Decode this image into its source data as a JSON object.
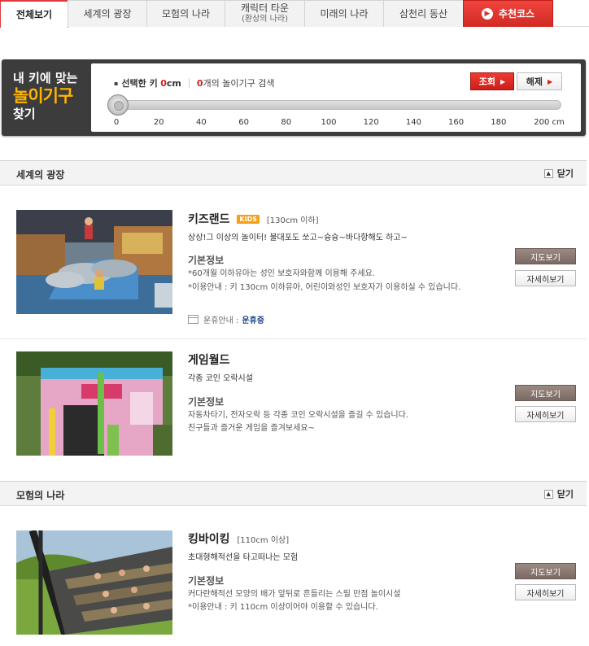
{
  "tabs": [
    {
      "label": "전체보기",
      "sub": ""
    },
    {
      "label": "세계의 광장",
      "sub": ""
    },
    {
      "label": "모험의 나라",
      "sub": ""
    },
    {
      "label": "캐릭터 타운",
      "sub": "(환상의 나라)"
    },
    {
      "label": "미래의 나라",
      "sub": ""
    },
    {
      "label": "삼천리 동산",
      "sub": ""
    }
  ],
  "reco_tab": "추천코스",
  "finder": {
    "title_line1": "내 키에 맞는",
    "title_line2": "놀이기구",
    "title_line3": "찾기",
    "selected_label": "선택한 키",
    "selected_value": "0",
    "selected_unit": "cm",
    "count_value": "0",
    "count_label": "개의 놀이기구 검색",
    "search_button": "조회",
    "reset_button": "해제",
    "slider_value": 0,
    "ticks": [
      "0",
      "20",
      "40",
      "60",
      "80",
      "100",
      "120",
      "140",
      "160",
      "180",
      "200 cm"
    ]
  },
  "sections": [
    {
      "title": "세계의 광장",
      "close_label": "닫기"
    },
    {
      "title": "모험의 나라",
      "close_label": "닫기"
    }
  ],
  "items": [
    {
      "name": "키즈랜드",
      "badge": "KIDS",
      "restriction": "[130cm 이하]",
      "desc": "상상!그 이상의 놀이터! 불대포도 쏘고~슝슝~바다항해도 하고~",
      "info_title": "기본정보",
      "lines": [
        "*60개월 이하유아는 성인 보호자와함께 이용해 주세요.",
        "*이용안내 : 키 130cm 이하유아, 어린이와성인 보호자가 이용하실 수 있습니다."
      ],
      "op_label": "운휴안내 :",
      "op_status": "운휴중",
      "map_button": "지도보기",
      "detail_button": "자세히보기"
    },
    {
      "name": "게임월드",
      "badge": "",
      "restriction": "",
      "desc": "각종 코인 오락시설",
      "info_title": "기본정보",
      "lines": [
        "자동차타기, 전자오락 등 각종 코인 오락시설을 즐길 수 있습니다.",
        "친구들과 즐거운 게임을 즐겨보세요~"
      ],
      "map_button": "지도보기",
      "detail_button": "자세히보기"
    },
    {
      "name": "킹바이킹",
      "badge": "",
      "restriction": "[110cm 이상]",
      "desc": "초대형해적선을 타고떠나는 모험",
      "info_title": "기본정보",
      "lines": [
        "커다란해적선 모양의 배가 앞뒤로 흔들리는 스릴 만점 놀이시설",
        "*이용안내 : 키 110cm 이상이어야 이용할 수 있습니다."
      ],
      "map_button": "지도보기",
      "detail_button": "자세히보기"
    }
  ],
  "colors": {
    "accent_red": "#d0211b",
    "finder_bg": "#3c3c3c",
    "finder_highlight": "#ffb400",
    "map_button": "#8b7a72"
  }
}
